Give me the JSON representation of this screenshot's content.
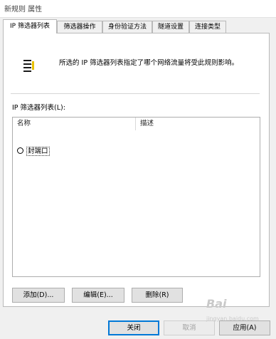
{
  "window": {
    "title": "新规则 属性"
  },
  "tabs": [
    {
      "label": "IP 筛选器列表",
      "active": true
    },
    {
      "label": "筛选器操作",
      "active": false
    },
    {
      "label": "身份验证方法",
      "active": false
    },
    {
      "label": "隧道设置",
      "active": false
    },
    {
      "label": "连接类型",
      "active": false
    }
  ],
  "panel": {
    "description": "所选的 IP 筛选器列表指定了哪个网络流量将受此规则影响。",
    "list_label": "IP 筛选器列表(L):",
    "columns": {
      "name": "名称",
      "description": "描述"
    },
    "rows": [
      {
        "name": "封端口",
        "description": "",
        "selected": true
      }
    ],
    "buttons": {
      "add": "添加(D)...",
      "edit": "编辑(E)...",
      "remove": "删除(R)"
    }
  },
  "dialog_buttons": {
    "close": "关闭",
    "cancel": "取消",
    "apply": "应用(A)"
  },
  "watermark": {
    "text": "Bai",
    "sub": "jingyan.baidu.com"
  },
  "icons": {
    "filter": "filter-list-icon",
    "radio": "radio-selected-icon"
  }
}
